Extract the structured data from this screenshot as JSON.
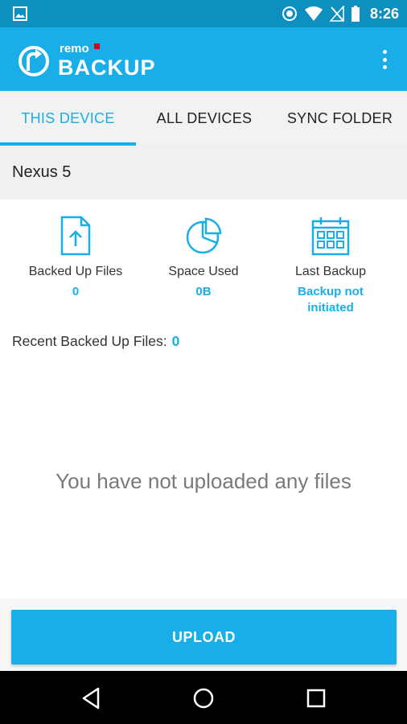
{
  "status_bar": {
    "time": "8:26",
    "icons": [
      "image-icon",
      "dnd-icon",
      "wifi-icon",
      "no-signal-icon",
      "battery-icon"
    ]
  },
  "app_bar": {
    "logo_small": "remo",
    "logo_main": "BACKUP",
    "menu_icon": "more-vert-icon"
  },
  "tabs": [
    {
      "label": "THIS DEVICE",
      "active": true
    },
    {
      "label": "ALL DEVICES",
      "active": false
    },
    {
      "label": "SYNC FOLDER",
      "active": false
    }
  ],
  "device": {
    "name": "Nexus 5"
  },
  "stats": [
    {
      "icon": "file-upload-icon",
      "label": "Backed Up Files",
      "value": "0"
    },
    {
      "icon": "pie-chart-icon",
      "label": "Space Used",
      "value": "0B"
    },
    {
      "icon": "calendar-icon",
      "label": "Last Backup",
      "value_line1": "Backup not",
      "value_line2": "initiated"
    }
  ],
  "recent": {
    "label": "Recent Backed Up Files:",
    "count": "0"
  },
  "empty_message": "You have not uploaded any files",
  "upload_button": "UPLOAD",
  "nav_bar": [
    "back-icon",
    "home-icon",
    "recents-icon"
  ],
  "colors": {
    "accent": "#19aee8",
    "status_bar": "#0d8fbf",
    "text_dark": "#222222",
    "text_muted": "#7a7a7a"
  }
}
